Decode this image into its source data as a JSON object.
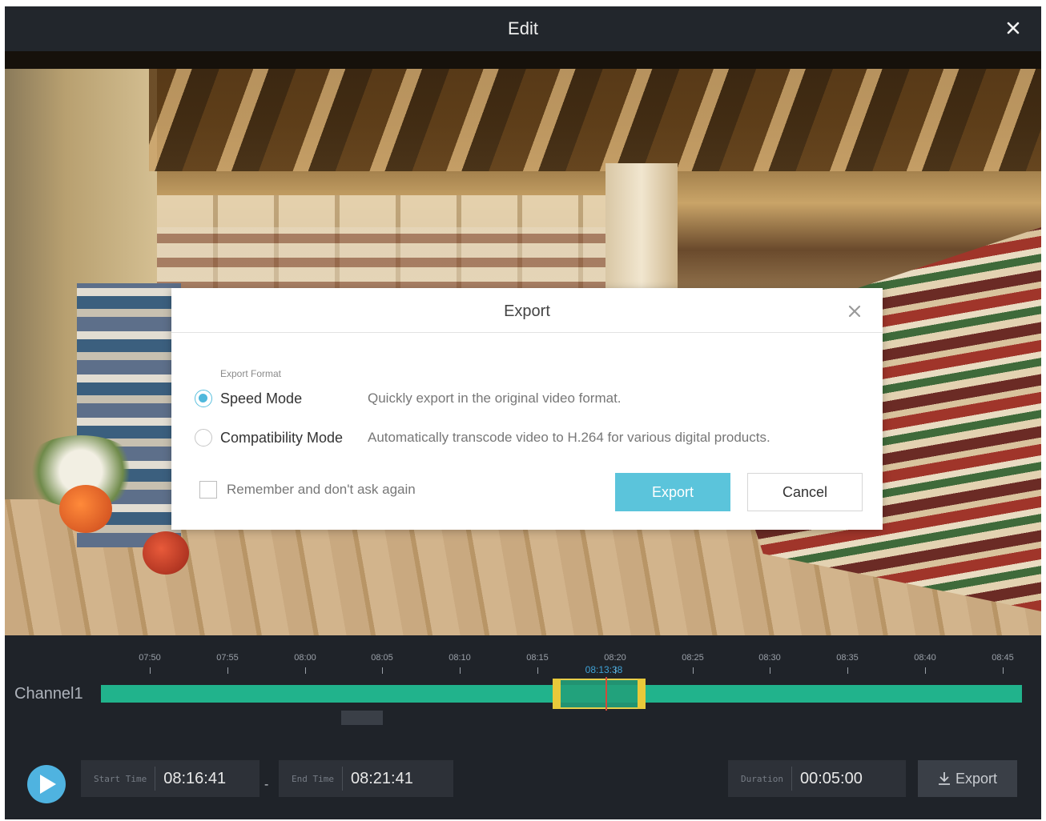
{
  "window": {
    "title": "Edit"
  },
  "export_dialog": {
    "title": "Export",
    "format_label": "Export Format",
    "options": [
      {
        "name": "Speed Mode",
        "description": "Quickly export in the original video format.",
        "selected": true
      },
      {
        "name": "Compatibility Mode",
        "description": "Automatically transcode video to H.264 for various digital products.",
        "selected": false
      }
    ],
    "remember_label": "Remember and don't ask again",
    "export_button": "Export",
    "cancel_button": "Cancel"
  },
  "timeline": {
    "channel": "Channel1",
    "ticks": [
      "07:50",
      "07:55",
      "08:00",
      "08:05",
      "08:10",
      "08:15",
      "08:20",
      "08:25",
      "08:30",
      "08:35",
      "08:40",
      "08:45"
    ],
    "cursor_time": "08:13:38"
  },
  "controls": {
    "start_label": "Start Time",
    "start_value": "08:16:41",
    "separator": "-",
    "end_label": "End Time",
    "end_value": "08:21:41",
    "duration_label": "Duration",
    "duration_value": "00:05:00",
    "export_label": "Export"
  },
  "colors": {
    "accent": "#5bc4db",
    "track": "#21b38c",
    "selection_border": "#e7cf4b",
    "background": "#1f2329"
  }
}
